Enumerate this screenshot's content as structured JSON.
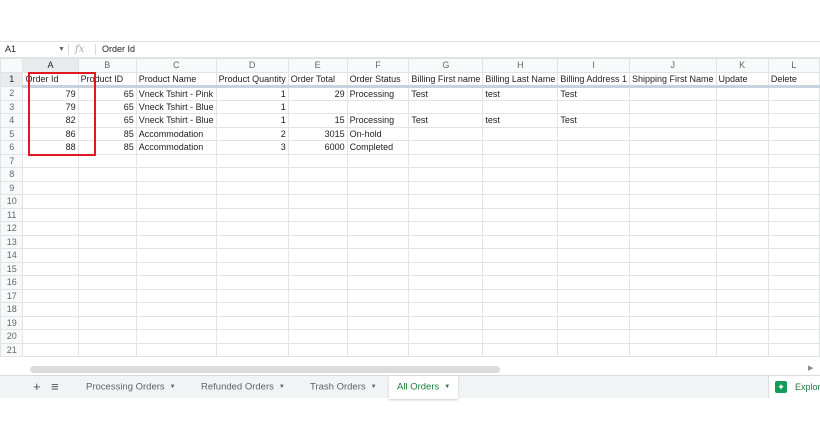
{
  "formula_bar": {
    "cell_ref": "A1",
    "fx_symbol": "fx",
    "formula": "Order Id"
  },
  "sheet": {
    "columns": [
      "A",
      "B",
      "C",
      "D",
      "E",
      "F",
      "G",
      "H",
      "I",
      "J",
      "K",
      "L"
    ],
    "rows": [
      {
        "num": "1",
        "cells": [
          "Order Id",
          "Product ID",
          "Product Name",
          "Product Quantity",
          "Order Total",
          "Order Status",
          "Billing First name",
          "Billing Last Name",
          "Billing Address 1",
          "Shipping First Name",
          "Update",
          "Delete"
        ]
      },
      {
        "num": "2",
        "cells": [
          "79",
          "65",
          "Vneck Tshirt - Pink",
          "1",
          "29",
          "Processing",
          "Test",
          "test",
          "Test",
          "",
          "",
          ""
        ]
      },
      {
        "num": "3",
        "cells": [
          "79",
          "65",
          "Vneck Tshirt - Blue",
          "1",
          "",
          "",
          "",
          "",
          "",
          "",
          "",
          ""
        ]
      },
      {
        "num": "4",
        "cells": [
          "82",
          "65",
          "Vneck Tshirt - Blue",
          "1",
          "15",
          "Processing",
          "Test",
          "test",
          "Test",
          "",
          "",
          ""
        ]
      },
      {
        "num": "5",
        "cells": [
          "86",
          "85",
          "Accommodation",
          "2",
          "3015",
          "On-hold",
          "",
          "",
          "",
          "",
          "",
          ""
        ]
      },
      {
        "num": "6",
        "cells": [
          "88",
          "85",
          "Accommodation",
          "3",
          "6000",
          "Completed",
          "",
          "",
          "",
          "",
          "",
          ""
        ]
      },
      {
        "num": "7",
        "cells": [
          "",
          "",
          "",
          "",
          "",
          "",
          "",
          "",
          "",
          "",
          "",
          ""
        ]
      },
      {
        "num": "8",
        "cells": [
          "",
          "",
          "",
          "",
          "",
          "",
          "",
          "",
          "",
          "",
          "",
          ""
        ]
      },
      {
        "num": "9",
        "cells": [
          "",
          "",
          "",
          "",
          "",
          "",
          "",
          "",
          "",
          "",
          "",
          ""
        ]
      },
      {
        "num": "10",
        "cells": [
          "",
          "",
          "",
          "",
          "",
          "",
          "",
          "",
          "",
          "",
          "",
          ""
        ]
      },
      {
        "num": "11",
        "cells": [
          "",
          "",
          "",
          "",
          "",
          "",
          "",
          "",
          "",
          "",
          "",
          ""
        ]
      },
      {
        "num": "12",
        "cells": [
          "",
          "",
          "",
          "",
          "",
          "",
          "",
          "",
          "",
          "",
          "",
          ""
        ]
      },
      {
        "num": "13",
        "cells": [
          "",
          "",
          "",
          "",
          "",
          "",
          "",
          "",
          "",
          "",
          "",
          ""
        ]
      },
      {
        "num": "14",
        "cells": [
          "",
          "",
          "",
          "",
          "",
          "",
          "",
          "",
          "",
          "",
          "",
          ""
        ]
      },
      {
        "num": "15",
        "cells": [
          "",
          "",
          "",
          "",
          "",
          "",
          "",
          "",
          "",
          "",
          "",
          ""
        ]
      },
      {
        "num": "16",
        "cells": [
          "",
          "",
          "",
          "",
          "",
          "",
          "",
          "",
          "",
          "",
          "",
          ""
        ]
      },
      {
        "num": "17",
        "cells": [
          "",
          "",
          "",
          "",
          "",
          "",
          "",
          "",
          "",
          "",
          "",
          ""
        ]
      },
      {
        "num": "18",
        "cells": [
          "",
          "",
          "",
          "",
          "",
          "",
          "",
          "",
          "",
          "",
          "",
          ""
        ]
      },
      {
        "num": "19",
        "cells": [
          "",
          "",
          "",
          "",
          "",
          "",
          "",
          "",
          "",
          "",
          "",
          ""
        ]
      },
      {
        "num": "20",
        "cells": [
          "",
          "",
          "",
          "",
          "",
          "",
          "",
          "",
          "",
          "",
          "",
          ""
        ]
      },
      {
        "num": "21",
        "cells": [
          "",
          "",
          "",
          "",
          "",
          "",
          "",
          "",
          "",
          "",
          "",
          ""
        ]
      }
    ]
  },
  "tabs": {
    "add_icon": "+",
    "list_icon": "≡",
    "items": [
      {
        "label": "Processing Orders",
        "active": false
      },
      {
        "label": "Refunded Orders",
        "active": false
      },
      {
        "label": "Trash Orders",
        "active": false
      },
      {
        "label": "All Orders",
        "active": true
      }
    ],
    "explore_label": "Explore"
  },
  "colors": {
    "selection_border": "#e0191f",
    "active_tab": "#188038",
    "explore_icon": "#0f9d58"
  }
}
